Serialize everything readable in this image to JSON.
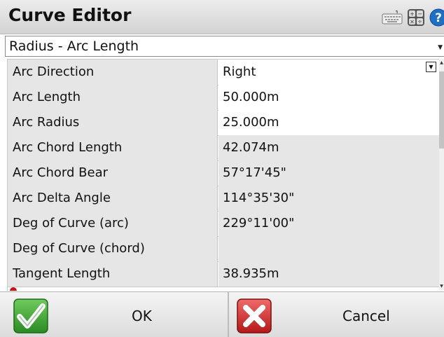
{
  "header": {
    "title": "Curve Editor",
    "icons": [
      "keyboard-icon",
      "calculator-icon",
      "help-icon"
    ]
  },
  "method": {
    "selected": "Radius - Arc Length"
  },
  "rows": [
    {
      "label": "Arc Direction",
      "value": "Right",
      "editable": true,
      "dropdown": true
    },
    {
      "label": "Arc Length",
      "value": "50.000m",
      "editable": true
    },
    {
      "label": "Arc Radius",
      "value": "25.000m",
      "editable": true
    },
    {
      "label": "Arc Chord Length",
      "value": "42.074m",
      "editable": false
    },
    {
      "label": "Arc Chord Bear",
      "value": "57°17'45\"",
      "editable": false
    },
    {
      "label": "Arc Delta Angle",
      "value": "114°35'30\"",
      "editable": false
    },
    {
      "label": "Deg of Curve (arc)",
      "value": "229°11'00\"",
      "editable": false
    },
    {
      "label": "Deg of Curve (chord)",
      "value": "",
      "editable": false
    },
    {
      "label": "Tangent Length",
      "value": "38.935m",
      "editable": false
    }
  ],
  "footer": {
    "ok_label": "OK",
    "cancel_label": "Cancel"
  },
  "colors": {
    "readonly_bg": "#e6e6e6",
    "ok_green": "#2f9a2a",
    "cancel_red": "#cc2222"
  }
}
